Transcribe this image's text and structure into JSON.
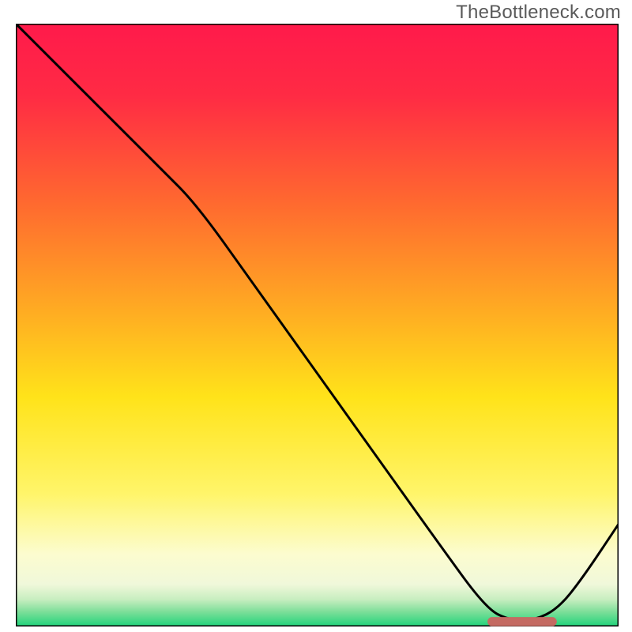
{
  "watermark": "TheBottleneck.com",
  "chart_data": {
    "type": "line",
    "title": "",
    "xlabel": "",
    "ylabel": "",
    "xlim": [
      0,
      100
    ],
    "ylim": [
      0,
      100
    ],
    "grid": false,
    "legend": false,
    "gradient_stops": [
      {
        "offset": 0.0,
        "color": "#ff1a4b"
      },
      {
        "offset": 0.12,
        "color": "#ff2b44"
      },
      {
        "offset": 0.3,
        "color": "#ff6a2f"
      },
      {
        "offset": 0.48,
        "color": "#ffad22"
      },
      {
        "offset": 0.62,
        "color": "#ffe31a"
      },
      {
        "offset": 0.78,
        "color": "#fff56a"
      },
      {
        "offset": 0.88,
        "color": "#fcfccf"
      },
      {
        "offset": 0.93,
        "color": "#f0f8da"
      },
      {
        "offset": 0.955,
        "color": "#c8eec0"
      },
      {
        "offset": 0.975,
        "color": "#7fdf9a"
      },
      {
        "offset": 1.0,
        "color": "#1fd37a"
      }
    ],
    "series": [
      {
        "name": "bottleneck-curve",
        "color": "#000000",
        "x": [
          0,
          6,
          12,
          18,
          24,
          30,
          40,
          50,
          60,
          70,
          78,
          82,
          86,
          90,
          94,
          100
        ],
        "y": [
          100,
          94,
          88,
          82,
          76,
          70,
          56,
          42,
          28,
          14,
          3,
          1,
          1,
          3,
          8,
          17
        ]
      }
    ],
    "marker": {
      "name": "optimal-region",
      "color": "#c46a62",
      "x_start": 79,
      "x_end": 89,
      "y": 0.8,
      "thickness": 1.5
    }
  }
}
